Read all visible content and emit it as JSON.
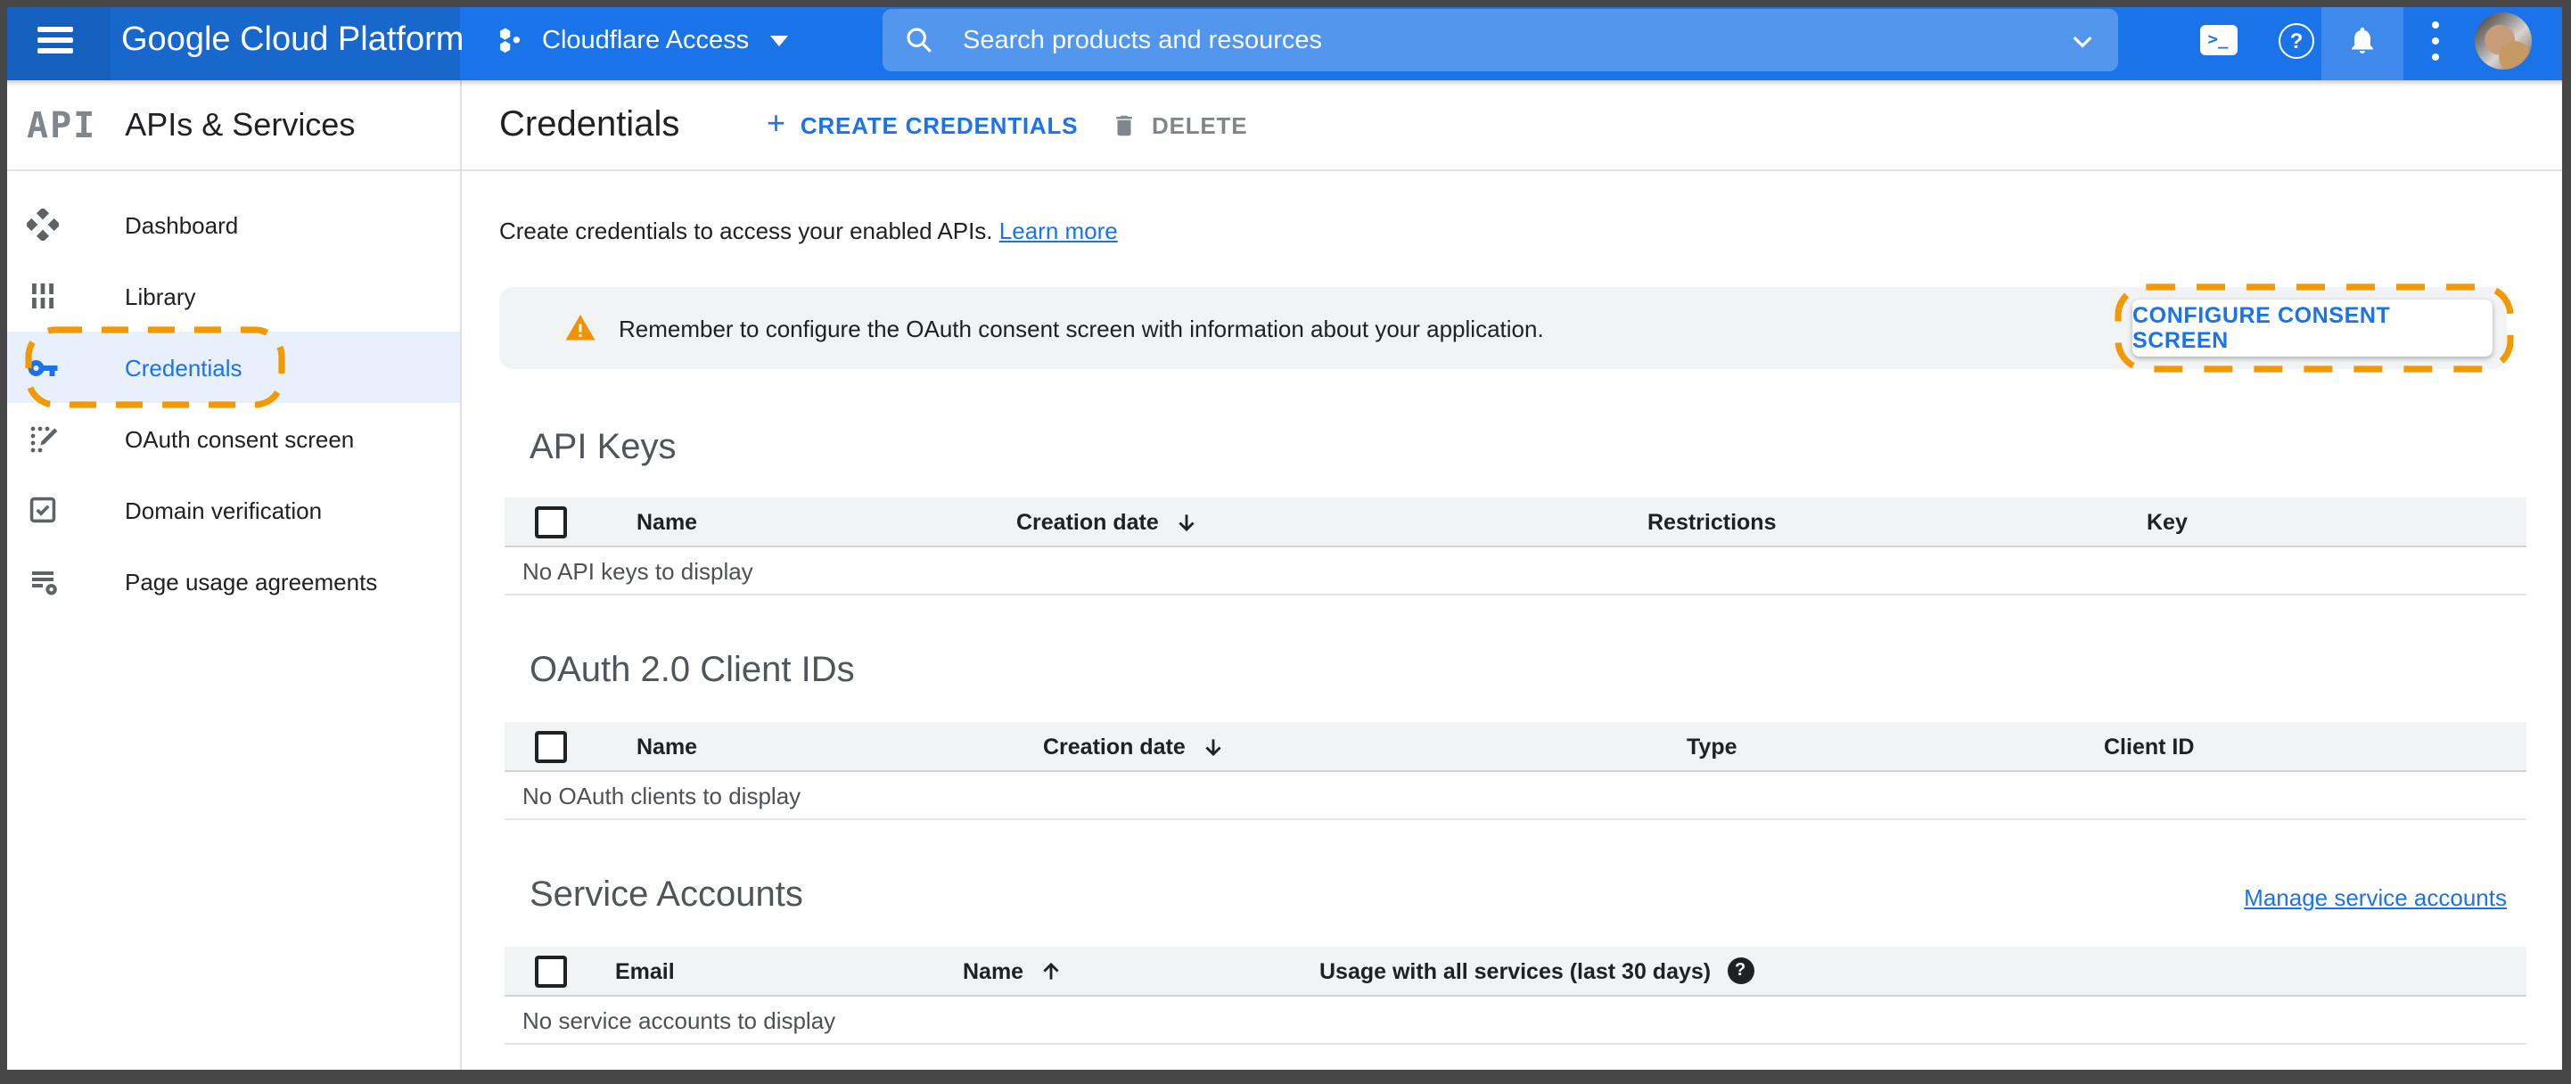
{
  "topbar": {
    "product_name": "Google Cloud Platform",
    "project_name": "Cloudflare Access",
    "search_placeholder": "Search products and resources"
  },
  "sidebar": {
    "logo_text": "API",
    "section_title": "APIs & Services",
    "items": [
      {
        "label": "Dashboard",
        "selected": false
      },
      {
        "label": "Library",
        "selected": false
      },
      {
        "label": "Credentials",
        "selected": true
      },
      {
        "label": "OAuth consent screen",
        "selected": false
      },
      {
        "label": "Domain verification",
        "selected": false
      },
      {
        "label": "Page usage agreements",
        "selected": false
      }
    ]
  },
  "header": {
    "title": "Credentials",
    "create_button": "CREATE CREDENTIALS",
    "delete_button": "DELETE"
  },
  "content": {
    "intro_text": "Create credentials to access your enabled APIs.",
    "learn_more": "Learn more",
    "banner": {
      "message": "Remember to configure the OAuth consent screen with information about your application.",
      "button": "CONFIGURE CONSENT SCREEN"
    },
    "api_keys": {
      "title": "API Keys",
      "columns": [
        "Name",
        "Creation date",
        "Restrictions",
        "Key"
      ],
      "empty_message": "No API keys to display"
    },
    "oauth_clients": {
      "title": "OAuth 2.0 Client IDs",
      "columns": [
        "Name",
        "Creation date",
        "Type",
        "Client ID"
      ],
      "empty_message": "No OAuth clients to display"
    },
    "service_accounts": {
      "title": "Service Accounts",
      "manage_link": "Manage service accounts",
      "columns": [
        "Email",
        "Name",
        "Usage with all services (last 30 days)"
      ],
      "empty_message": "No service accounts to display"
    }
  },
  "colors": {
    "header_blue": "#1a73e8",
    "header_blue_dark": "#1767cd",
    "accent_blue": "#1a73e8",
    "selected_item_bg": "#e8f0fe",
    "highlight_orange": "#f29900",
    "warning_icon_orange": "#f09300",
    "banner_bg": "#f1f3f4"
  }
}
